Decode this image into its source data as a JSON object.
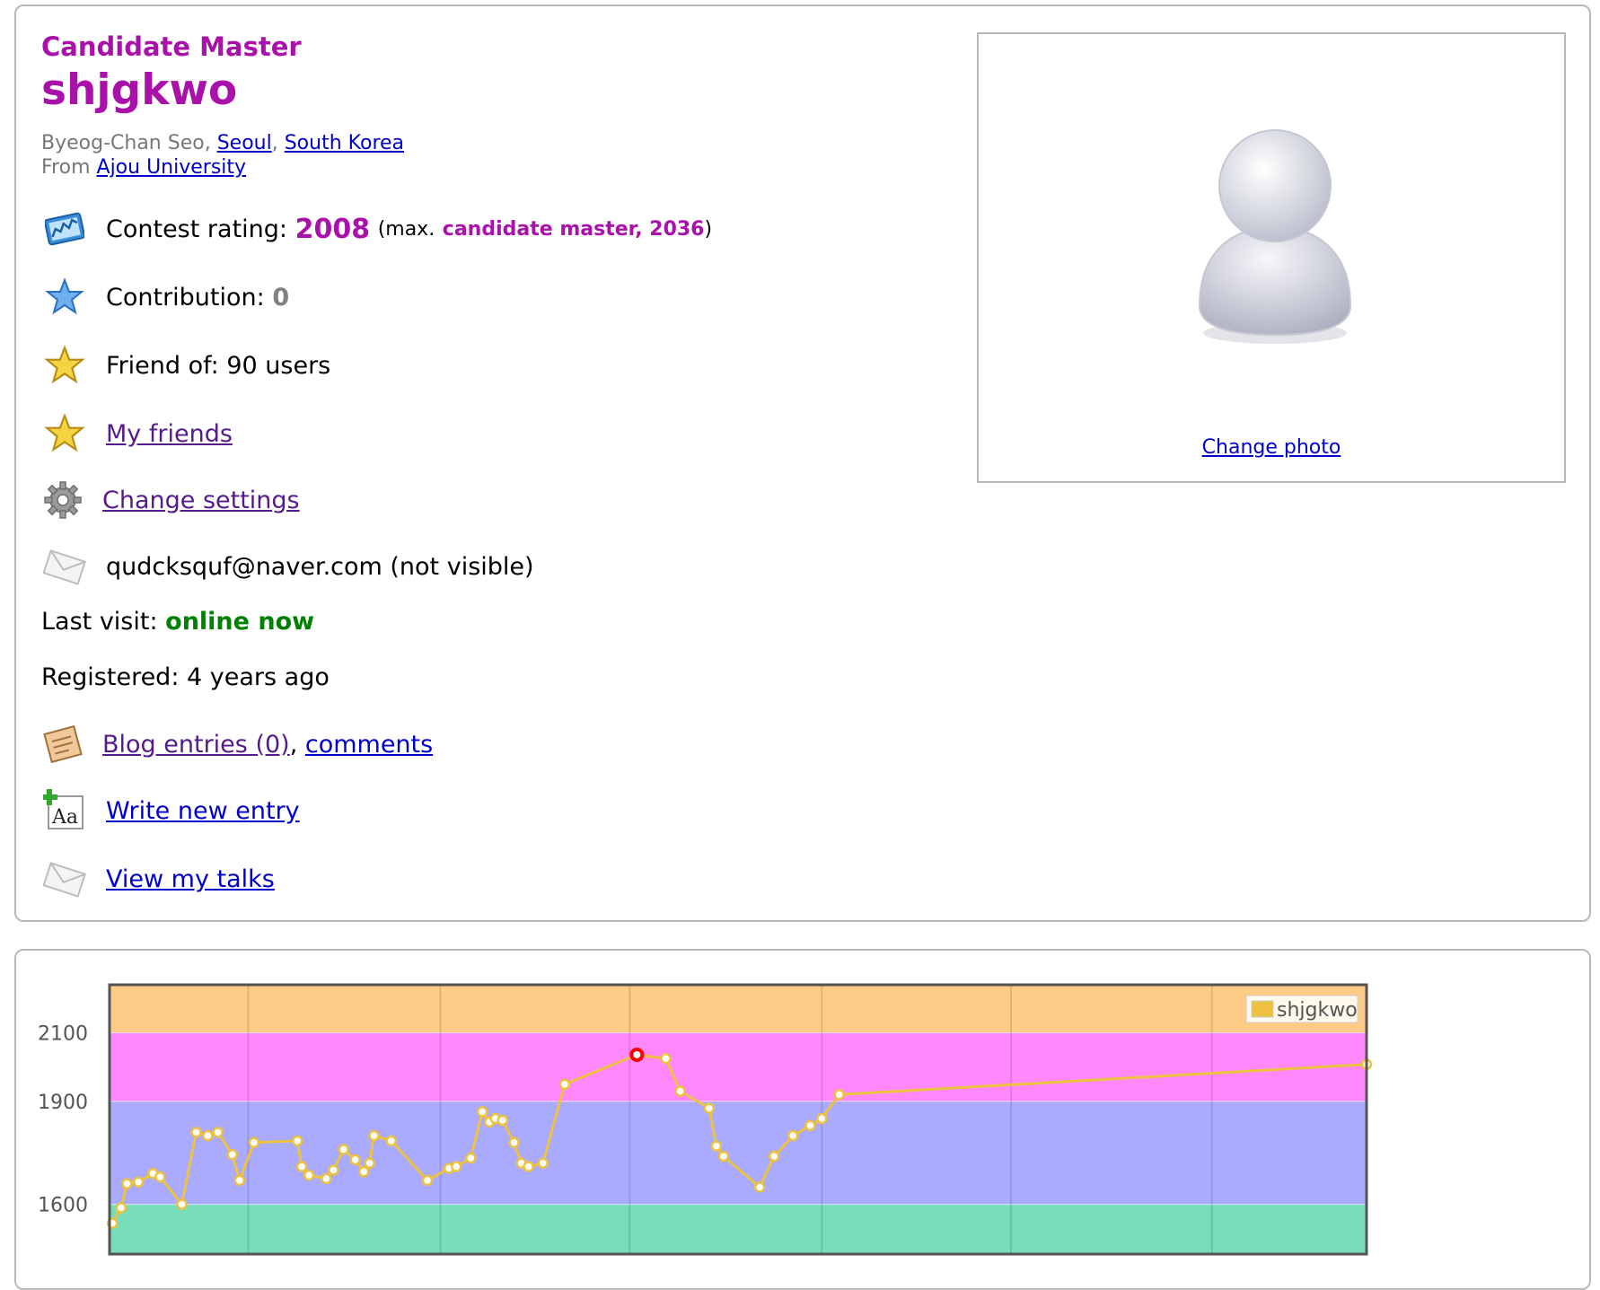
{
  "profile": {
    "rank": "Candidate Master",
    "handle": "shjgkwo",
    "name": "Byeog-Chan Seo",
    "city": "Seoul",
    "country": "South Korea",
    "from_label": "From",
    "organization": "Ajou University",
    "rating_label": "Contest rating:",
    "rating": "2008",
    "max_open": "(max.",
    "max_rank": "candidate master, 2036",
    "max_close": ")",
    "contribution_label": "Contribution:",
    "contribution": "0",
    "friend_of": "Friend of: 90 users",
    "my_friends": "My friends",
    "change_settings": "Change settings",
    "email": "qudcksquf@naver.com (not visible)",
    "last_visit_label": "Last visit:",
    "last_visit": "online now",
    "registered": "Registered: 4 years ago",
    "blog_entries": "Blog entries (0)",
    "comments": "comments",
    "write_new_entry": "Write new entry",
    "view_my_talks": "View my talks",
    "change_photo": "Change photo"
  },
  "icons": {
    "rating": "rating-graph-icon",
    "contribution": "blue-star-icon",
    "friend_of": "gold-star-icon",
    "my_friends": "gold-star-icon",
    "settings": "gear-icon",
    "email": "envelope-icon",
    "blog": "blog-notepad-icon",
    "write": "new-entry-icon",
    "talks": "envelope-icon",
    "avatar": "default-avatar-icon"
  },
  "colors": {
    "rank": "#aa11aa",
    "online": "#008000",
    "link": "#0000cc",
    "visited_link": "#551a8b",
    "series_line": "#edc240",
    "max_point": "#ff0000"
  },
  "chart_data": {
    "type": "line",
    "series": [
      {
        "name": "shjgkwo",
        "x": [
          0.2,
          0.8,
          1.2,
          2,
          3,
          3.5,
          5,
          6,
          6.8,
          7.5,
          8.5,
          9,
          10,
          13,
          13.3,
          13.8,
          15,
          15.5,
          16.2,
          17,
          17.6,
          18,
          18.3,
          19.5,
          22,
          23.5,
          24,
          25,
          25.8,
          26.3,
          26.7,
          27.2,
          28,
          28.5,
          29,
          30,
          31.5,
          36.5,
          38.5,
          39.5,
          41.5,
          42,
          42.5,
          45,
          46,
          47.3,
          48.5,
          49.3,
          50.5,
          87
        ],
        "y": [
          1545,
          1590,
          1660,
          1665,
          1690,
          1680,
          1600,
          1810,
          1800,
          1810,
          1745,
          1670,
          1780,
          1785,
          1710,
          1685,
          1675,
          1700,
          1760,
          1730,
          1695,
          1720,
          1800,
          1785,
          1670,
          1705,
          1710,
          1735,
          1870,
          1840,
          1850,
          1845,
          1780,
          1720,
          1710,
          1720,
          1950,
          2036,
          2025,
          1930,
          1880,
          1770,
          1740,
          1650,
          1740,
          1800,
          1830,
          1850,
          1920,
          2008
        ]
      }
    ],
    "max_point": {
      "x": 36.5,
      "y": 2036
    },
    "ylabels": [
      "1600",
      "1900",
      "2100"
    ],
    "ylim": [
      1455,
      2240
    ],
    "xlim": [
      0,
      87
    ],
    "bands": [
      {
        "from": 1400,
        "to": 1600,
        "color": "#77ddbb"
      },
      {
        "from": 1600,
        "to": 1900,
        "color": "#aaaaff"
      },
      {
        "from": 1900,
        "to": 2100,
        "color": "#ff88ff"
      },
      {
        "from": 2100,
        "to": 2300,
        "color": "#ffcc88"
      }
    ],
    "vertical_grid": [
      9.6,
      22.9,
      36,
      49.3,
      62.4,
      76.3
    ],
    "grid": true,
    "legend_position": "top-right"
  }
}
